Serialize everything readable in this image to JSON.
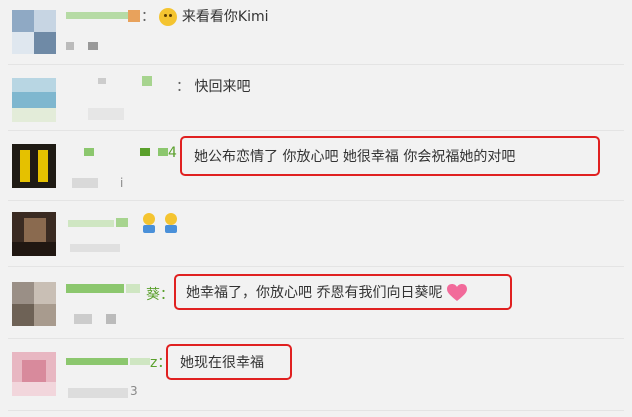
{
  "comments": [
    {
      "prefix": "：",
      "text": "来看看你Kimi",
      "emoji": "smiley-face-icon"
    },
    {
      "prefix": "：",
      "text": "快回来吧"
    },
    {
      "prefix": "4",
      "text": "她公布恋情了 你放心吧  她很幸福  你会祝福她的对吧",
      "meta": "i"
    },
    {
      "prefix": "",
      "text": "",
      "emoji": "hugging-figures-icon"
    },
    {
      "prefix": "葵：",
      "text": "她幸福了，你放心吧 乔恩有我们向日葵呢",
      "emoji": "heart-icon"
    },
    {
      "prefix": "z：",
      "text": "她现在很幸福",
      "meta": "3"
    }
  ],
  "colors": {
    "highlight": "#e02020",
    "background": "#f2f2f2",
    "username": "#5aa02c"
  }
}
